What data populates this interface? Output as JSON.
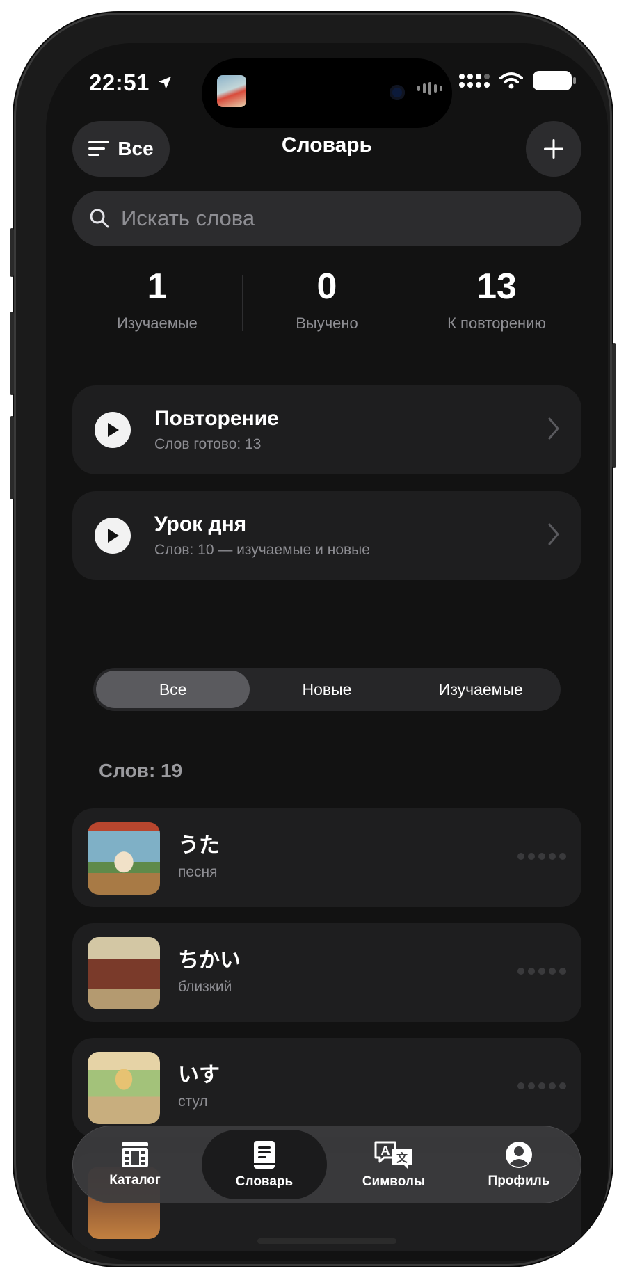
{
  "status_bar": {
    "time": "22:51"
  },
  "header": {
    "filter_label": "Все",
    "title": "Словарь"
  },
  "search": {
    "placeholder": "Искать слова"
  },
  "stats": [
    {
      "value": "1",
      "label": "Изучаемые"
    },
    {
      "value": "0",
      "label": "Выучено"
    },
    {
      "value": "13",
      "label": "К повторению"
    }
  ],
  "actions": [
    {
      "title": "Повторение",
      "subtitle": "Слов готово: 13"
    },
    {
      "title": "Урок дня",
      "subtitle": "Слов: 10 — изучаемые и новые"
    }
  ],
  "segments": [
    {
      "label": "Все",
      "active": true
    },
    {
      "label": "Новые",
      "active": false
    },
    {
      "label": "Изучаемые",
      "active": false
    }
  ],
  "word_count_label": "Слов: 19",
  "words": [
    {
      "jp": "うた",
      "ru": "песня"
    },
    {
      "jp": "ちかい",
      "ru": "близкий"
    },
    {
      "jp": "いす",
      "ru": "стул"
    }
  ],
  "tabbar": [
    {
      "label": "Каталог",
      "icon": "film-icon",
      "active": false
    },
    {
      "label": "Словарь",
      "icon": "notebook-icon",
      "active": true
    },
    {
      "label": "Символы",
      "icon": "translate-icon",
      "active": false
    },
    {
      "label": "Профиль",
      "icon": "profile-icon",
      "active": false
    }
  ]
}
